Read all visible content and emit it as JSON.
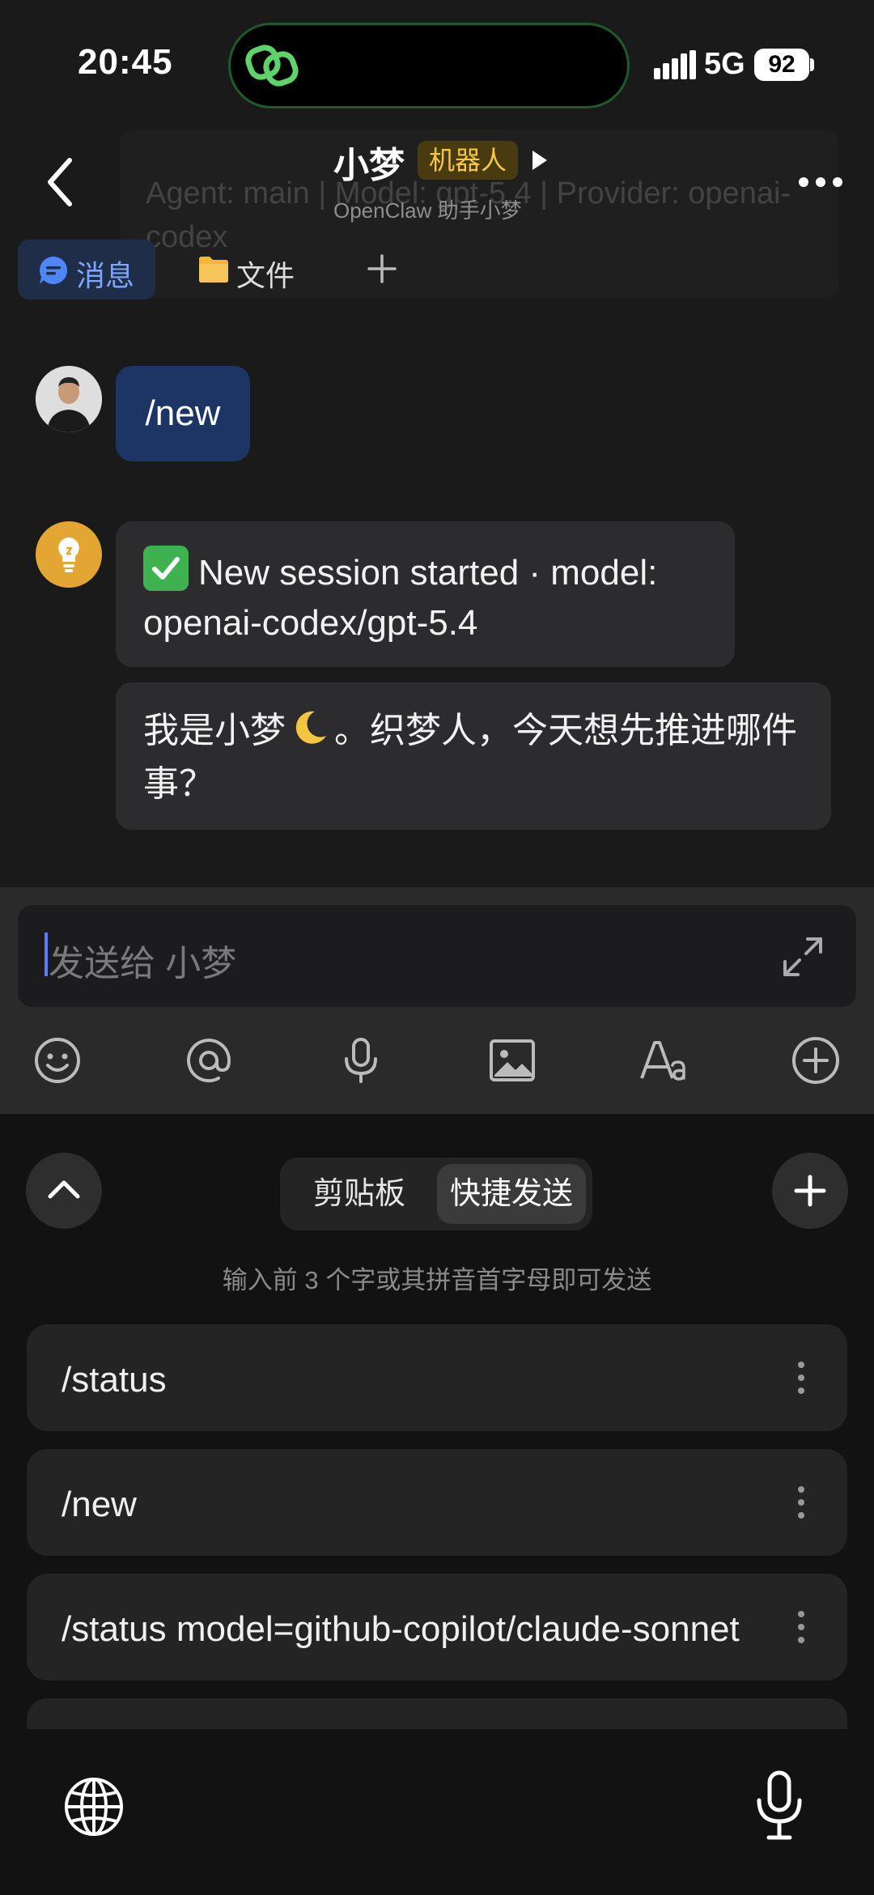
{
  "status_bar": {
    "time": "20:45",
    "network": "5G",
    "battery": "92"
  },
  "header": {
    "title": "小梦",
    "badge": "机器人",
    "subtitle": "OpenClaw 助手小梦",
    "ghost_text": "Agent: main | Model: gpt-5.4 | Provider: openai-codex"
  },
  "tabs": [
    {
      "label": "消息",
      "icon": "message-icon",
      "active": true
    },
    {
      "label": "文件",
      "icon": "folder-icon",
      "active": false
    }
  ],
  "messages": [
    {
      "sender": "user",
      "text": "/new"
    },
    {
      "sender": "bot",
      "text": "New session started · model: openai-codex/gpt-5.4"
    },
    {
      "sender": "bot",
      "text_before": "我是小梦",
      "text_after": "。织梦人，今天想先推进哪件事？"
    }
  ],
  "composer": {
    "placeholder": "发送给 小梦",
    "tools": [
      "emoji-icon",
      "mention-icon",
      "microphone-icon",
      "image-icon",
      "text-format-icon",
      "add-circle-icon"
    ]
  },
  "keyboard_panel": {
    "segments": [
      {
        "label": "剪贴板",
        "active": false
      },
      {
        "label": "快捷发送",
        "active": true
      }
    ],
    "hint": "输入前 3 个字或其拼音首字母即可发送",
    "quick_items": [
      "/status",
      "/new",
      "/status model=github-copilot/claude-sonnet"
    ]
  },
  "colors": {
    "accent_blue": "#7aa6ff",
    "user_bubble": "#1c3564",
    "bot_bubble": "#2c2c2e",
    "badge_text": "#f3c74a",
    "check_green": "#3fb14f"
  }
}
